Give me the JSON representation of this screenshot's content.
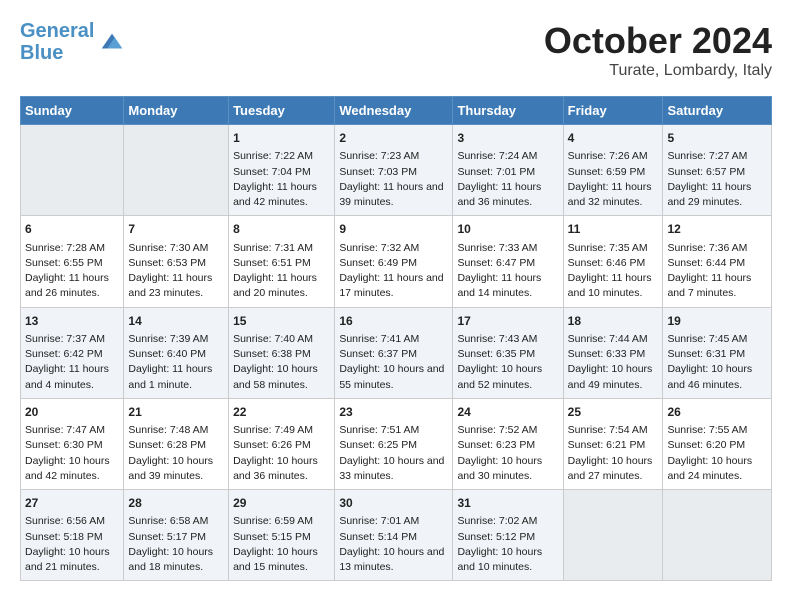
{
  "header": {
    "logo_line1": "General",
    "logo_line2": "Blue",
    "month": "October 2024",
    "location": "Turate, Lombardy, Italy"
  },
  "days_of_week": [
    "Sunday",
    "Monday",
    "Tuesday",
    "Wednesday",
    "Thursday",
    "Friday",
    "Saturday"
  ],
  "weeks": [
    [
      {
        "day": "",
        "empty": true
      },
      {
        "day": "",
        "empty": true
      },
      {
        "day": "1",
        "sunrise": "Sunrise: 7:22 AM",
        "sunset": "Sunset: 7:04 PM",
        "daylight": "Daylight: 11 hours and 42 minutes."
      },
      {
        "day": "2",
        "sunrise": "Sunrise: 7:23 AM",
        "sunset": "Sunset: 7:03 PM",
        "daylight": "Daylight: 11 hours and 39 minutes."
      },
      {
        "day": "3",
        "sunrise": "Sunrise: 7:24 AM",
        "sunset": "Sunset: 7:01 PM",
        "daylight": "Daylight: 11 hours and 36 minutes."
      },
      {
        "day": "4",
        "sunrise": "Sunrise: 7:26 AM",
        "sunset": "Sunset: 6:59 PM",
        "daylight": "Daylight: 11 hours and 32 minutes."
      },
      {
        "day": "5",
        "sunrise": "Sunrise: 7:27 AM",
        "sunset": "Sunset: 6:57 PM",
        "daylight": "Daylight: 11 hours and 29 minutes."
      }
    ],
    [
      {
        "day": "6",
        "sunrise": "Sunrise: 7:28 AM",
        "sunset": "Sunset: 6:55 PM",
        "daylight": "Daylight: 11 hours and 26 minutes."
      },
      {
        "day": "7",
        "sunrise": "Sunrise: 7:30 AM",
        "sunset": "Sunset: 6:53 PM",
        "daylight": "Daylight: 11 hours and 23 minutes."
      },
      {
        "day": "8",
        "sunrise": "Sunrise: 7:31 AM",
        "sunset": "Sunset: 6:51 PM",
        "daylight": "Daylight: 11 hours and 20 minutes."
      },
      {
        "day": "9",
        "sunrise": "Sunrise: 7:32 AM",
        "sunset": "Sunset: 6:49 PM",
        "daylight": "Daylight: 11 hours and 17 minutes."
      },
      {
        "day": "10",
        "sunrise": "Sunrise: 7:33 AM",
        "sunset": "Sunset: 6:47 PM",
        "daylight": "Daylight: 11 hours and 14 minutes."
      },
      {
        "day": "11",
        "sunrise": "Sunrise: 7:35 AM",
        "sunset": "Sunset: 6:46 PM",
        "daylight": "Daylight: 11 hours and 10 minutes."
      },
      {
        "day": "12",
        "sunrise": "Sunrise: 7:36 AM",
        "sunset": "Sunset: 6:44 PM",
        "daylight": "Daylight: 11 hours and 7 minutes."
      }
    ],
    [
      {
        "day": "13",
        "sunrise": "Sunrise: 7:37 AM",
        "sunset": "Sunset: 6:42 PM",
        "daylight": "Daylight: 11 hours and 4 minutes."
      },
      {
        "day": "14",
        "sunrise": "Sunrise: 7:39 AM",
        "sunset": "Sunset: 6:40 PM",
        "daylight": "Daylight: 11 hours and 1 minute."
      },
      {
        "day": "15",
        "sunrise": "Sunrise: 7:40 AM",
        "sunset": "Sunset: 6:38 PM",
        "daylight": "Daylight: 10 hours and 58 minutes."
      },
      {
        "day": "16",
        "sunrise": "Sunrise: 7:41 AM",
        "sunset": "Sunset: 6:37 PM",
        "daylight": "Daylight: 10 hours and 55 minutes."
      },
      {
        "day": "17",
        "sunrise": "Sunrise: 7:43 AM",
        "sunset": "Sunset: 6:35 PM",
        "daylight": "Daylight: 10 hours and 52 minutes."
      },
      {
        "day": "18",
        "sunrise": "Sunrise: 7:44 AM",
        "sunset": "Sunset: 6:33 PM",
        "daylight": "Daylight: 10 hours and 49 minutes."
      },
      {
        "day": "19",
        "sunrise": "Sunrise: 7:45 AM",
        "sunset": "Sunset: 6:31 PM",
        "daylight": "Daylight: 10 hours and 46 minutes."
      }
    ],
    [
      {
        "day": "20",
        "sunrise": "Sunrise: 7:47 AM",
        "sunset": "Sunset: 6:30 PM",
        "daylight": "Daylight: 10 hours and 42 minutes."
      },
      {
        "day": "21",
        "sunrise": "Sunrise: 7:48 AM",
        "sunset": "Sunset: 6:28 PM",
        "daylight": "Daylight: 10 hours and 39 minutes."
      },
      {
        "day": "22",
        "sunrise": "Sunrise: 7:49 AM",
        "sunset": "Sunset: 6:26 PM",
        "daylight": "Daylight: 10 hours and 36 minutes."
      },
      {
        "day": "23",
        "sunrise": "Sunrise: 7:51 AM",
        "sunset": "Sunset: 6:25 PM",
        "daylight": "Daylight: 10 hours and 33 minutes."
      },
      {
        "day": "24",
        "sunrise": "Sunrise: 7:52 AM",
        "sunset": "Sunset: 6:23 PM",
        "daylight": "Daylight: 10 hours and 30 minutes."
      },
      {
        "day": "25",
        "sunrise": "Sunrise: 7:54 AM",
        "sunset": "Sunset: 6:21 PM",
        "daylight": "Daylight: 10 hours and 27 minutes."
      },
      {
        "day": "26",
        "sunrise": "Sunrise: 7:55 AM",
        "sunset": "Sunset: 6:20 PM",
        "daylight": "Daylight: 10 hours and 24 minutes."
      }
    ],
    [
      {
        "day": "27",
        "sunrise": "Sunrise: 6:56 AM",
        "sunset": "Sunset: 5:18 PM",
        "daylight": "Daylight: 10 hours and 21 minutes."
      },
      {
        "day": "28",
        "sunrise": "Sunrise: 6:58 AM",
        "sunset": "Sunset: 5:17 PM",
        "daylight": "Daylight: 10 hours and 18 minutes."
      },
      {
        "day": "29",
        "sunrise": "Sunrise: 6:59 AM",
        "sunset": "Sunset: 5:15 PM",
        "daylight": "Daylight: 10 hours and 15 minutes."
      },
      {
        "day": "30",
        "sunrise": "Sunrise: 7:01 AM",
        "sunset": "Sunset: 5:14 PM",
        "daylight": "Daylight: 10 hours and 13 minutes."
      },
      {
        "day": "31",
        "sunrise": "Sunrise: 7:02 AM",
        "sunset": "Sunset: 5:12 PM",
        "daylight": "Daylight: 10 hours and 10 minutes."
      },
      {
        "day": "",
        "empty": true
      },
      {
        "day": "",
        "empty": true
      }
    ]
  ]
}
